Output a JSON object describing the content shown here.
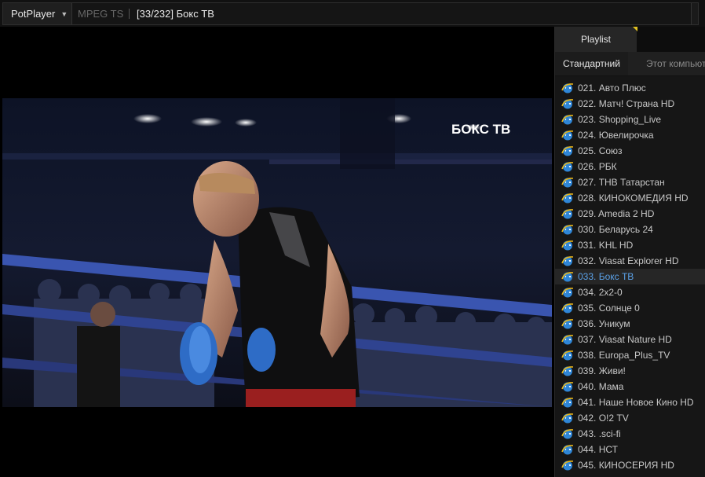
{
  "titlebar": {
    "app_name": "PotPlayer",
    "format": "MPEG TS",
    "media_title": "[33/232] Бокс ТВ"
  },
  "video": {
    "channel_logo": "БОКС ТВ"
  },
  "playlist": {
    "tab_label": "Playlist",
    "subtabs": [
      "Стандартний",
      "Этот компьютер"
    ],
    "current_index": 12,
    "item_icon": "internet-explorer-icon",
    "items": [
      "021. Авто Плюс",
      "022. Матч! Страна HD",
      "023. Shopping_Live",
      "024. Ювелирочка",
      "025. Союз",
      "026. РБК",
      "027. ТНВ Татарстан",
      "028. КИНОКОМЕДИЯ HD",
      "029. Amedia 2 HD",
      "030. Беларусь 24",
      "031. KHL HD",
      "032. Viasat Explorer HD",
      "033. Бокс ТВ",
      "034. 2x2-0",
      "035. Солнце 0",
      "036. Уникум",
      "037. Viasat Nature HD",
      "038. Europa_Plus_TV",
      "039. Живи!",
      "040. Мама",
      "041. Наше Новое Кино HD",
      "042. О!2 TV",
      "043. .sci-fi",
      "044. НСТ",
      "045. КИНОСЕРИЯ HD"
    ],
    "colors": {
      "current": "#5aa0e6",
      "icon_blue": "#2f86d6",
      "icon_ring": "#e8b61c"
    }
  }
}
